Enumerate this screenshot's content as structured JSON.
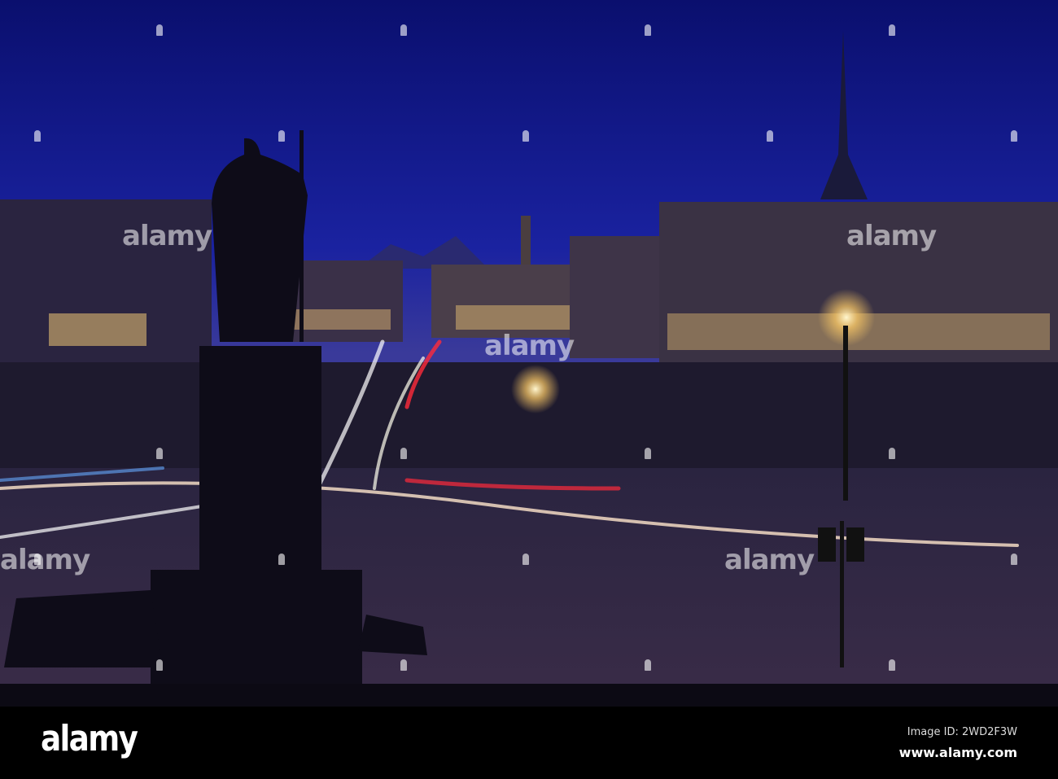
{
  "footer": {
    "logo": "alamy",
    "image_id": "Image ID: 2WD2F3W",
    "website": "www.alamy.com"
  },
  "watermark": "alamy",
  "colors": {
    "sky_top": "#0a0f6e",
    "sky_bottom": "#3a3fb0",
    "lights": "#ffd27a",
    "trail_red": "#ff2a3a"
  }
}
